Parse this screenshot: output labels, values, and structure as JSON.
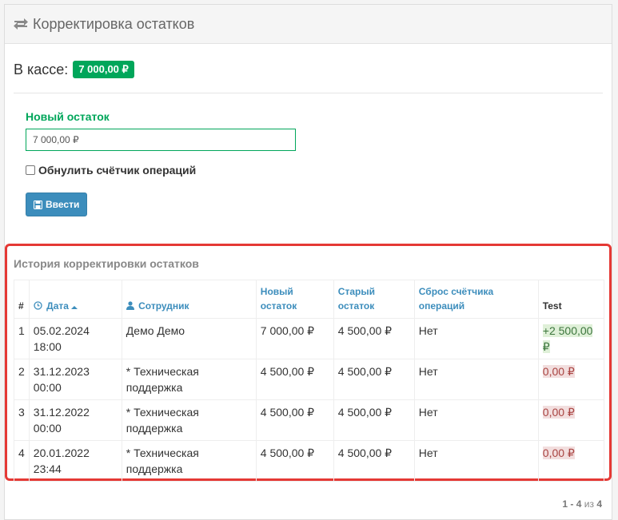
{
  "header": {
    "title": "Корректировка остатков",
    "icon": "exchange-icon"
  },
  "balance": {
    "label": "В кассе:",
    "value": "7 000,00 ₽"
  },
  "form": {
    "new_balance_label": "Новый остаток",
    "new_balance_value": "7 000,00 ₽",
    "reset_counter_label": "Обнулить счётчик операций",
    "reset_counter_checked": false,
    "submit_label": "Ввести"
  },
  "history": {
    "title": "История корректировки остатков",
    "columns": {
      "num": "#",
      "date": "Дата",
      "employee": "Сотрудник",
      "new_balance": "Новый остаток",
      "old_balance": "Старый остаток",
      "reset": "Сброс счётчика операций",
      "test": "Test"
    },
    "rows": [
      {
        "num": "1",
        "date": "05.02.2024 18:00",
        "employee": "Демо Демо",
        "new_balance": "7 000,00 ₽",
        "old_balance": "4 500,00 ₽",
        "reset": "Нет",
        "test": "+2 500,00 ₽",
        "test_type": "positive"
      },
      {
        "num": "2",
        "date": "31.12.2023 00:00",
        "employee": "* Техническая поддержка",
        "new_balance": "4 500,00 ₽",
        "old_balance": "4 500,00 ₽",
        "reset": "Нет",
        "test": "0,00 ₽",
        "test_type": "zero"
      },
      {
        "num": "3",
        "date": "31.12.2022 00:00",
        "employee": "* Техническая поддержка",
        "new_balance": "4 500,00 ₽",
        "old_balance": "4 500,00 ₽",
        "reset": "Нет",
        "test": "0,00 ₽",
        "test_type": "zero"
      },
      {
        "num": "4",
        "date": "20.01.2022 23:44",
        "employee": "* Техническая поддержка",
        "new_balance": "4 500,00 ₽",
        "old_balance": "4 500,00 ₽",
        "reset": "Нет",
        "test": "0,00 ₽",
        "test_type": "zero"
      }
    ]
  },
  "pagination": {
    "range": "1 - 4",
    "of": "из",
    "total": "4"
  },
  "colors": {
    "accent": "#3c8dbc",
    "success": "#00a65a",
    "highlight": "#e53935"
  }
}
